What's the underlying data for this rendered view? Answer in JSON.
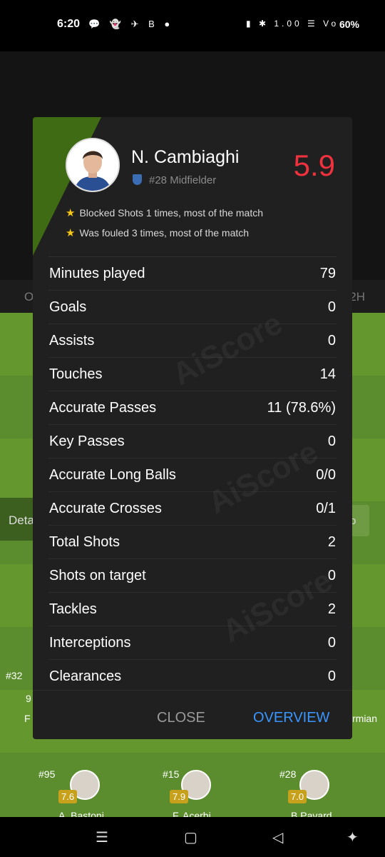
{
  "status_bar": {
    "time": "6:20",
    "left_icons": "💬 👻 ✈ B ●",
    "sys_icons": "▮ ✱ 1.00 ☰ Vo",
    "battery": "60%"
  },
  "background": {
    "tab_left": "O",
    "tab_right": "2H",
    "detail_label": "Deta",
    "pro_label": "ro",
    "players": [
      {
        "number": "#32",
        "name": "F",
        "rating": "9"
      },
      {
        "number": "#95",
        "name": "A. Bastoni",
        "rating": "7.6"
      },
      {
        "number": "#15",
        "name": "F. Acerbi",
        "rating": "7.9"
      },
      {
        "number": "#28",
        "name": "B.Pavard",
        "rating": "7.0"
      },
      {
        "name": "rmian"
      }
    ]
  },
  "player": {
    "name": "N. Cambiaghi",
    "meta": "#28 Midfielder",
    "rating": "5.9",
    "rating_color": "#f0313e",
    "highlights": [
      "Blocked Shots 1 times, most of the match",
      "Was fouled 3 times, most of the match"
    ]
  },
  "stats": [
    {
      "label": "Minutes played",
      "value": "79"
    },
    {
      "label": "Goals",
      "value": "0"
    },
    {
      "label": "Assists",
      "value": "0"
    },
    {
      "label": "Touches",
      "value": "14"
    },
    {
      "label": "Accurate Passes",
      "value": "11 (78.6%)"
    },
    {
      "label": "Key Passes",
      "value": "0"
    },
    {
      "label": "Accurate Long Balls",
      "value": "0/0"
    },
    {
      "label": "Accurate Crosses",
      "value": "0/1"
    },
    {
      "label": "Total Shots",
      "value": "2"
    },
    {
      "label": "Shots on target",
      "value": "0"
    },
    {
      "label": "Tackles",
      "value": "2"
    },
    {
      "label": "Interceptions",
      "value": "0"
    },
    {
      "label": "Clearances",
      "value": "0"
    }
  ],
  "footer": {
    "close_label": "CLOSE",
    "overview_label": "OVERVIEW",
    "overview_color": "#3a96ff"
  },
  "watermark_text": "AiScore",
  "nav": {
    "recent": "☰",
    "home": "▢",
    "back": "◁",
    "accessibility": "✦"
  }
}
